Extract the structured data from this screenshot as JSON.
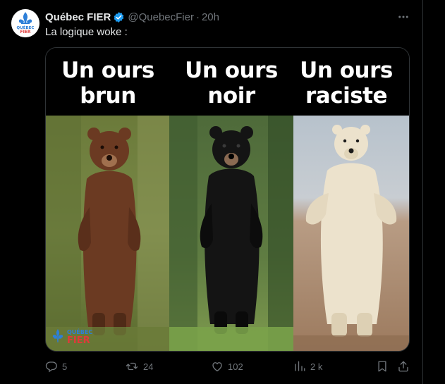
{
  "tweet": {
    "display_name": "Québec FIER",
    "handle": "@QuebecFier",
    "separator": "·",
    "time": "20h",
    "text": "La logique woke :",
    "verified": true,
    "avatar_label_top": "QUÉBEC",
    "avatar_label_bottom": "FIER"
  },
  "meme": {
    "captions": [
      "Un ours\nbrun",
      "Un ours\nnoir",
      "Un ours\nraciste"
    ],
    "panels": [
      "brown-bear",
      "black-bear",
      "polar-bear"
    ],
    "watermark": {
      "line1": "QUÉBEC",
      "line2": "FIER"
    }
  },
  "actions": {
    "replies": "5",
    "retweets": "24",
    "likes": "102",
    "views": "2 k"
  },
  "colors": {
    "background": "#000000",
    "text": "#e7e9ea",
    "secondary": "#71767b",
    "verified": "#1d9bf0",
    "border": "#2f3336",
    "brand_blue": "#2d7fd8",
    "brand_red": "#e03a3a"
  },
  "icons": [
    "more-icon",
    "verified-badge-icon",
    "reply-icon",
    "retweet-icon",
    "like-icon",
    "views-icon",
    "bookmark-icon",
    "share-icon",
    "fleur-de-lis-icon"
  ]
}
